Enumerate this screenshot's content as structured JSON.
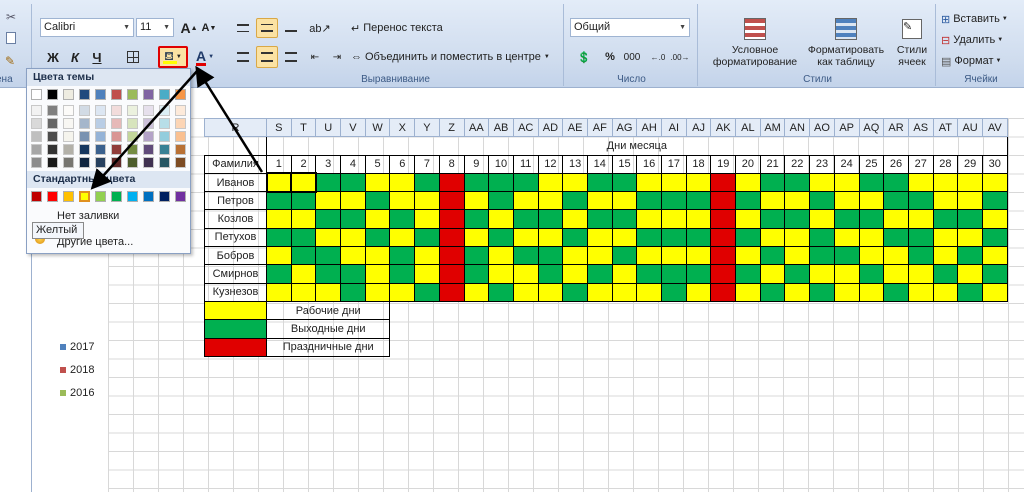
{
  "ribbon": {
    "font_name": "Calibri",
    "font_size": "11",
    "wrap_text": "Перенос текста",
    "merge_center": "Объединить и поместить в центре",
    "number_format": "Общий",
    "percent": "%",
    "thousands": "000",
    "cond_format": [
      "Условное",
      "форматирование"
    ],
    "format_table": [
      "Форматировать",
      "как таблицу"
    ],
    "cell_styles": [
      "Стили",
      "ячеек"
    ],
    "insert": "Вставить",
    "delete": "Удалить",
    "format": "Формат",
    "group_alignment": "Выравнивание",
    "group_number": "Число",
    "group_styles": "Стили",
    "group_cells": "Ячейки",
    "group_left": "ена"
  },
  "popup": {
    "theme_colors": "Цвета темы",
    "standard_colors": "Стандартные цвета",
    "no_fill": "Нет заливки",
    "more_colors": "Другие цвета...",
    "tooltip": "Желтый",
    "theme_top": [
      "#ffffff",
      "#000000",
      "#eeece1",
      "#1f497d",
      "#4f81bd",
      "#c0504d",
      "#9bbb59",
      "#8064a2",
      "#4bacc6",
      "#f79646"
    ],
    "standard": [
      "#c00000",
      "#ff0000",
      "#ffc000",
      "#ffff00",
      "#92d050",
      "#00b050",
      "#00b0f0",
      "#0070c0",
      "#002060",
      "#7030a0"
    ]
  },
  "sheet": {
    "partial_header": "R",
    "col_letters": [
      "S",
      "T",
      "U",
      "V",
      "W",
      "X",
      "Y",
      "Z",
      "AA",
      "AB",
      "AC",
      "AD",
      "AE",
      "AF",
      "AG",
      "AH",
      "AI",
      "AJ",
      "AK",
      "AL",
      "AM",
      "AN",
      "AO",
      "AP",
      "AQ",
      "AR",
      "AS",
      "AT",
      "AU",
      "AV"
    ],
    "title": "Дни месяца",
    "surname_header": "Фамилия",
    "days": [
      "1",
      "2",
      "3",
      "4",
      "5",
      "6",
      "7",
      "8",
      "9",
      "10",
      "11",
      "12",
      "13",
      "14",
      "15",
      "16",
      "17",
      "18",
      "19",
      "20",
      "21",
      "22",
      "23",
      "24",
      "25",
      "26",
      "27",
      "28",
      "29",
      "30"
    ],
    "names": [
      "Иванов",
      "Петров",
      "Козлов",
      "Петухов",
      "Бобров",
      "Смирнов",
      "Кузнезов"
    ],
    "rows": [
      "YYGGYYGRGGGYYGGYYYRYGGYYGGYYYY",
      "GGYYGYYRYGYYGYYGGGRGYYGYYGGYYG",
      "YYGGYGYRGYGGYGGYYYRYGGYGGYYGGY",
      "GGYYGYGRYGYYGYYGGGRGYYGYYGGYYG",
      "YGGYYGYRGYGGYYGYYYRYGYGGYYGYGY",
      "GYGGYGYRGYYGYGYGGGRGYGYYGYYGYG",
      "YYYGYYGRYGYYGYYYGYRYGYGYYGYYGY"
    ],
    "legend": [
      "Рабочие дни",
      "Выходные дни",
      "Праздничные дни"
    ],
    "colors": {
      "Y": "#ffff00",
      "G": "#00b050",
      "R": "#e00000"
    },
    "chart_legend": [
      {
        "label": "2017",
        "color": "#4f81bd"
      },
      {
        "label": "2018",
        "color": "#c0504d"
      },
      {
        "label": "2016",
        "color": "#9bbb59"
      }
    ]
  }
}
